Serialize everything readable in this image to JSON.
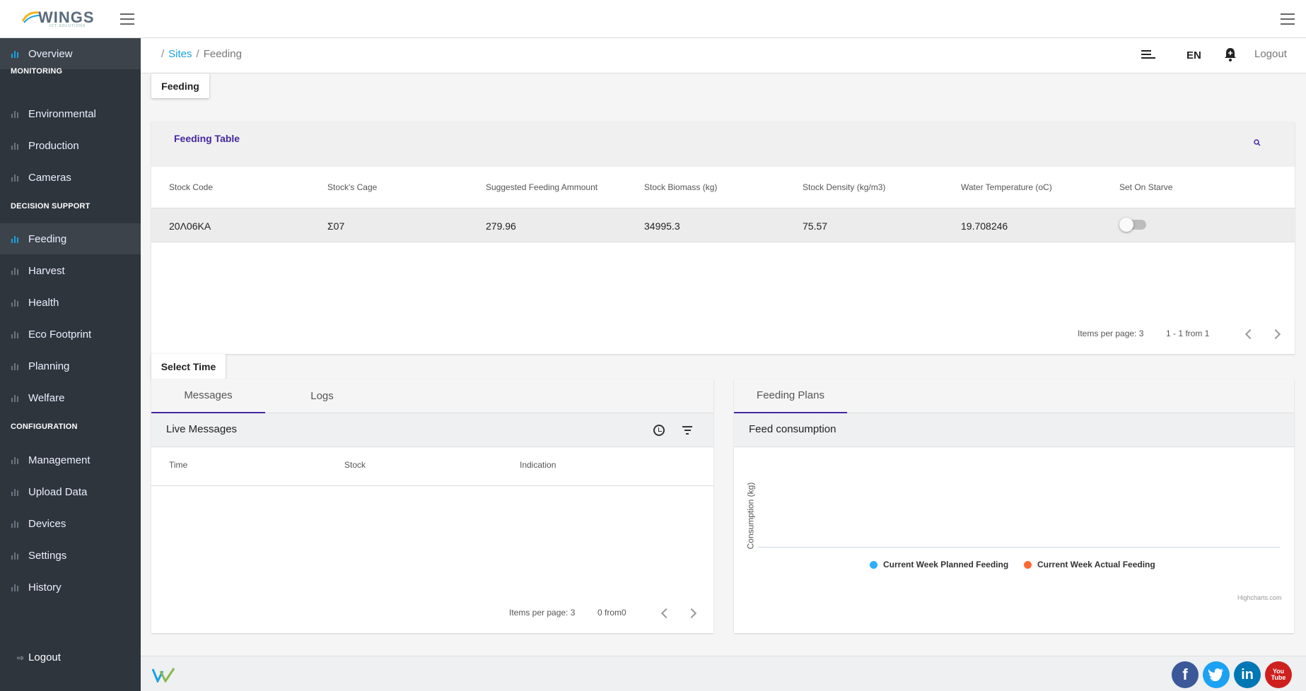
{
  "app": {
    "logo_text": "WINGS",
    "logo_subtext": "ICT SOLUTIONS"
  },
  "sidebar": {
    "items": [
      {
        "label": "Overview",
        "active": true
      },
      {
        "label": "Environmental"
      },
      {
        "label": "Production"
      },
      {
        "label": "Cameras"
      },
      {
        "label": "Feeding",
        "active": true
      },
      {
        "label": "Harvest"
      },
      {
        "label": "Health"
      },
      {
        "label": "Eco Footprint"
      },
      {
        "label": "Planning"
      },
      {
        "label": "Welfare"
      },
      {
        "label": "Management"
      },
      {
        "label": "Upload Data"
      },
      {
        "label": "Devices"
      },
      {
        "label": "Settings"
      },
      {
        "label": "History"
      }
    ],
    "sections": {
      "monitoring": "MONITORING",
      "decision_support": "DECISION SUPPORT",
      "configuration": "CONFIGURATION"
    },
    "logout": "Logout"
  },
  "header": {
    "breadcrumb": [
      "Sites",
      "Feeding"
    ],
    "language": "EN",
    "logout": "Logout"
  },
  "feeding_chip": "Feeding",
  "feeding_table": {
    "title": "Feeding Table",
    "columns": [
      "Stock Code",
      "Stock's Cage",
      "Suggested Feeding Ammount",
      "Stock Biomass (kg)",
      "Stock Density (kg/m3)",
      "Water Temperature (oC)",
      "Set On Starve"
    ],
    "rows": [
      {
        "stock_code": "20Λ06ΚΑ",
        "cage": "Σ07",
        "suggested": "279.96",
        "biomass": "34995.3",
        "density": "75.57",
        "water_temp": "19.708246",
        "starve": false
      }
    ],
    "pager": {
      "items_per_page": "Items per page: 3",
      "range": "1 - 1 from 1"
    }
  },
  "select_time": "Select Time",
  "messages": {
    "tabs": [
      "Messages",
      "Logs"
    ],
    "title": "Live Messages",
    "columns": [
      "Time",
      "Stock",
      "Indication"
    ],
    "pager": {
      "items_per_page": "Items per page: 3",
      "range": "0 from0"
    }
  },
  "plans": {
    "tab": "Feeding Plans",
    "title": "Feed consumption",
    "chart_data": {
      "type": "line",
      "title": "",
      "xlabel": "",
      "ylabel": "Consumption (kg)",
      "series": [
        {
          "name": "Current Week Planned Feeding",
          "values": [],
          "color": "#2caffe"
        },
        {
          "name": "Current Week Actual Feeding",
          "values": [],
          "color": "#fe6a35"
        }
      ],
      "legend": "bottom-center",
      "credits": "Highcharts.com"
    }
  },
  "footer": {
    "social": [
      "f",
      "t",
      "in",
      "You Tube"
    ],
    "colors": {
      "facebook": "#3b5998",
      "twitter": "#1da1f2",
      "linkedin": "#0077b5",
      "youtube": "#cd201f"
    }
  },
  "colors": {
    "accent": "#1ba1e2",
    "brand_purple": "#4527a0",
    "sidebar_bg": "#2e353d"
  }
}
